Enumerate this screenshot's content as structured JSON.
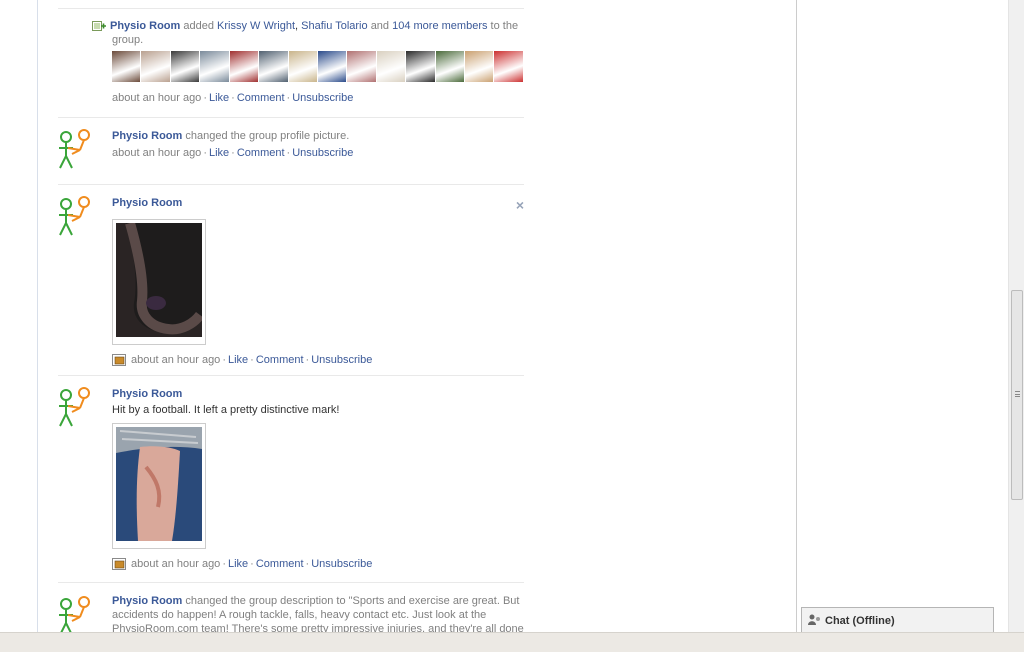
{
  "feed": {
    "story1": {
      "actor": "Physio Room",
      "verb": "added",
      "member1": "Krissy W Wright",
      "sep": ",",
      "member2": "Shafiu Tolario",
      "and": "and",
      "more": "104 more members",
      "tail": "to the group.",
      "time": "about an hour ago",
      "like": "Like",
      "comment": "Comment",
      "unsub": "Unsubscribe",
      "thumb_colors": [
        "#6b4a3a",
        "#b9a08f",
        "#3a3a3a",
        "#7a8a9a",
        "#a03030",
        "#506070",
        "#c9b48a",
        "#2a4a8a",
        "#b07070",
        "#d9d0c0",
        "#2a2a2a",
        "#4a6a3a",
        "#caa070",
        "#cc3030"
      ]
    },
    "story2": {
      "actor": "Physio Room",
      "text": "changed the group profile picture.",
      "time": "about an hour ago",
      "like": "Like",
      "comment": "Comment",
      "unsub": "Unsubscribe"
    },
    "story3": {
      "actor": "Physio Room",
      "close": "×",
      "time": "about an hour ago",
      "like": "Like",
      "comment": "Comment",
      "unsub": "Unsubscribe"
    },
    "story4": {
      "actor": "Physio Room",
      "caption": "Hit by a football. It left a pretty distinctive mark!",
      "time": "about an hour ago",
      "like": "Like",
      "comment": "Comment",
      "unsub": "Unsubscribe"
    },
    "story5": {
      "actor": "Physio Room",
      "text": "changed the group description to \"Sports and exercise are great. But accidents do happen! A rough tackle, falls, heavy contact etc. Just look at the PhysioRoom.com team! There's some pretty impressive injuries, and they're all done in the"
    },
    "separator_dot": "·"
  },
  "chat": {
    "label": "Chat (Offline)"
  },
  "colors": {
    "link": "#3b5998",
    "meta": "#808080",
    "avatar_green": "#3aa53a",
    "avatar_orange": "#f08c1e"
  }
}
